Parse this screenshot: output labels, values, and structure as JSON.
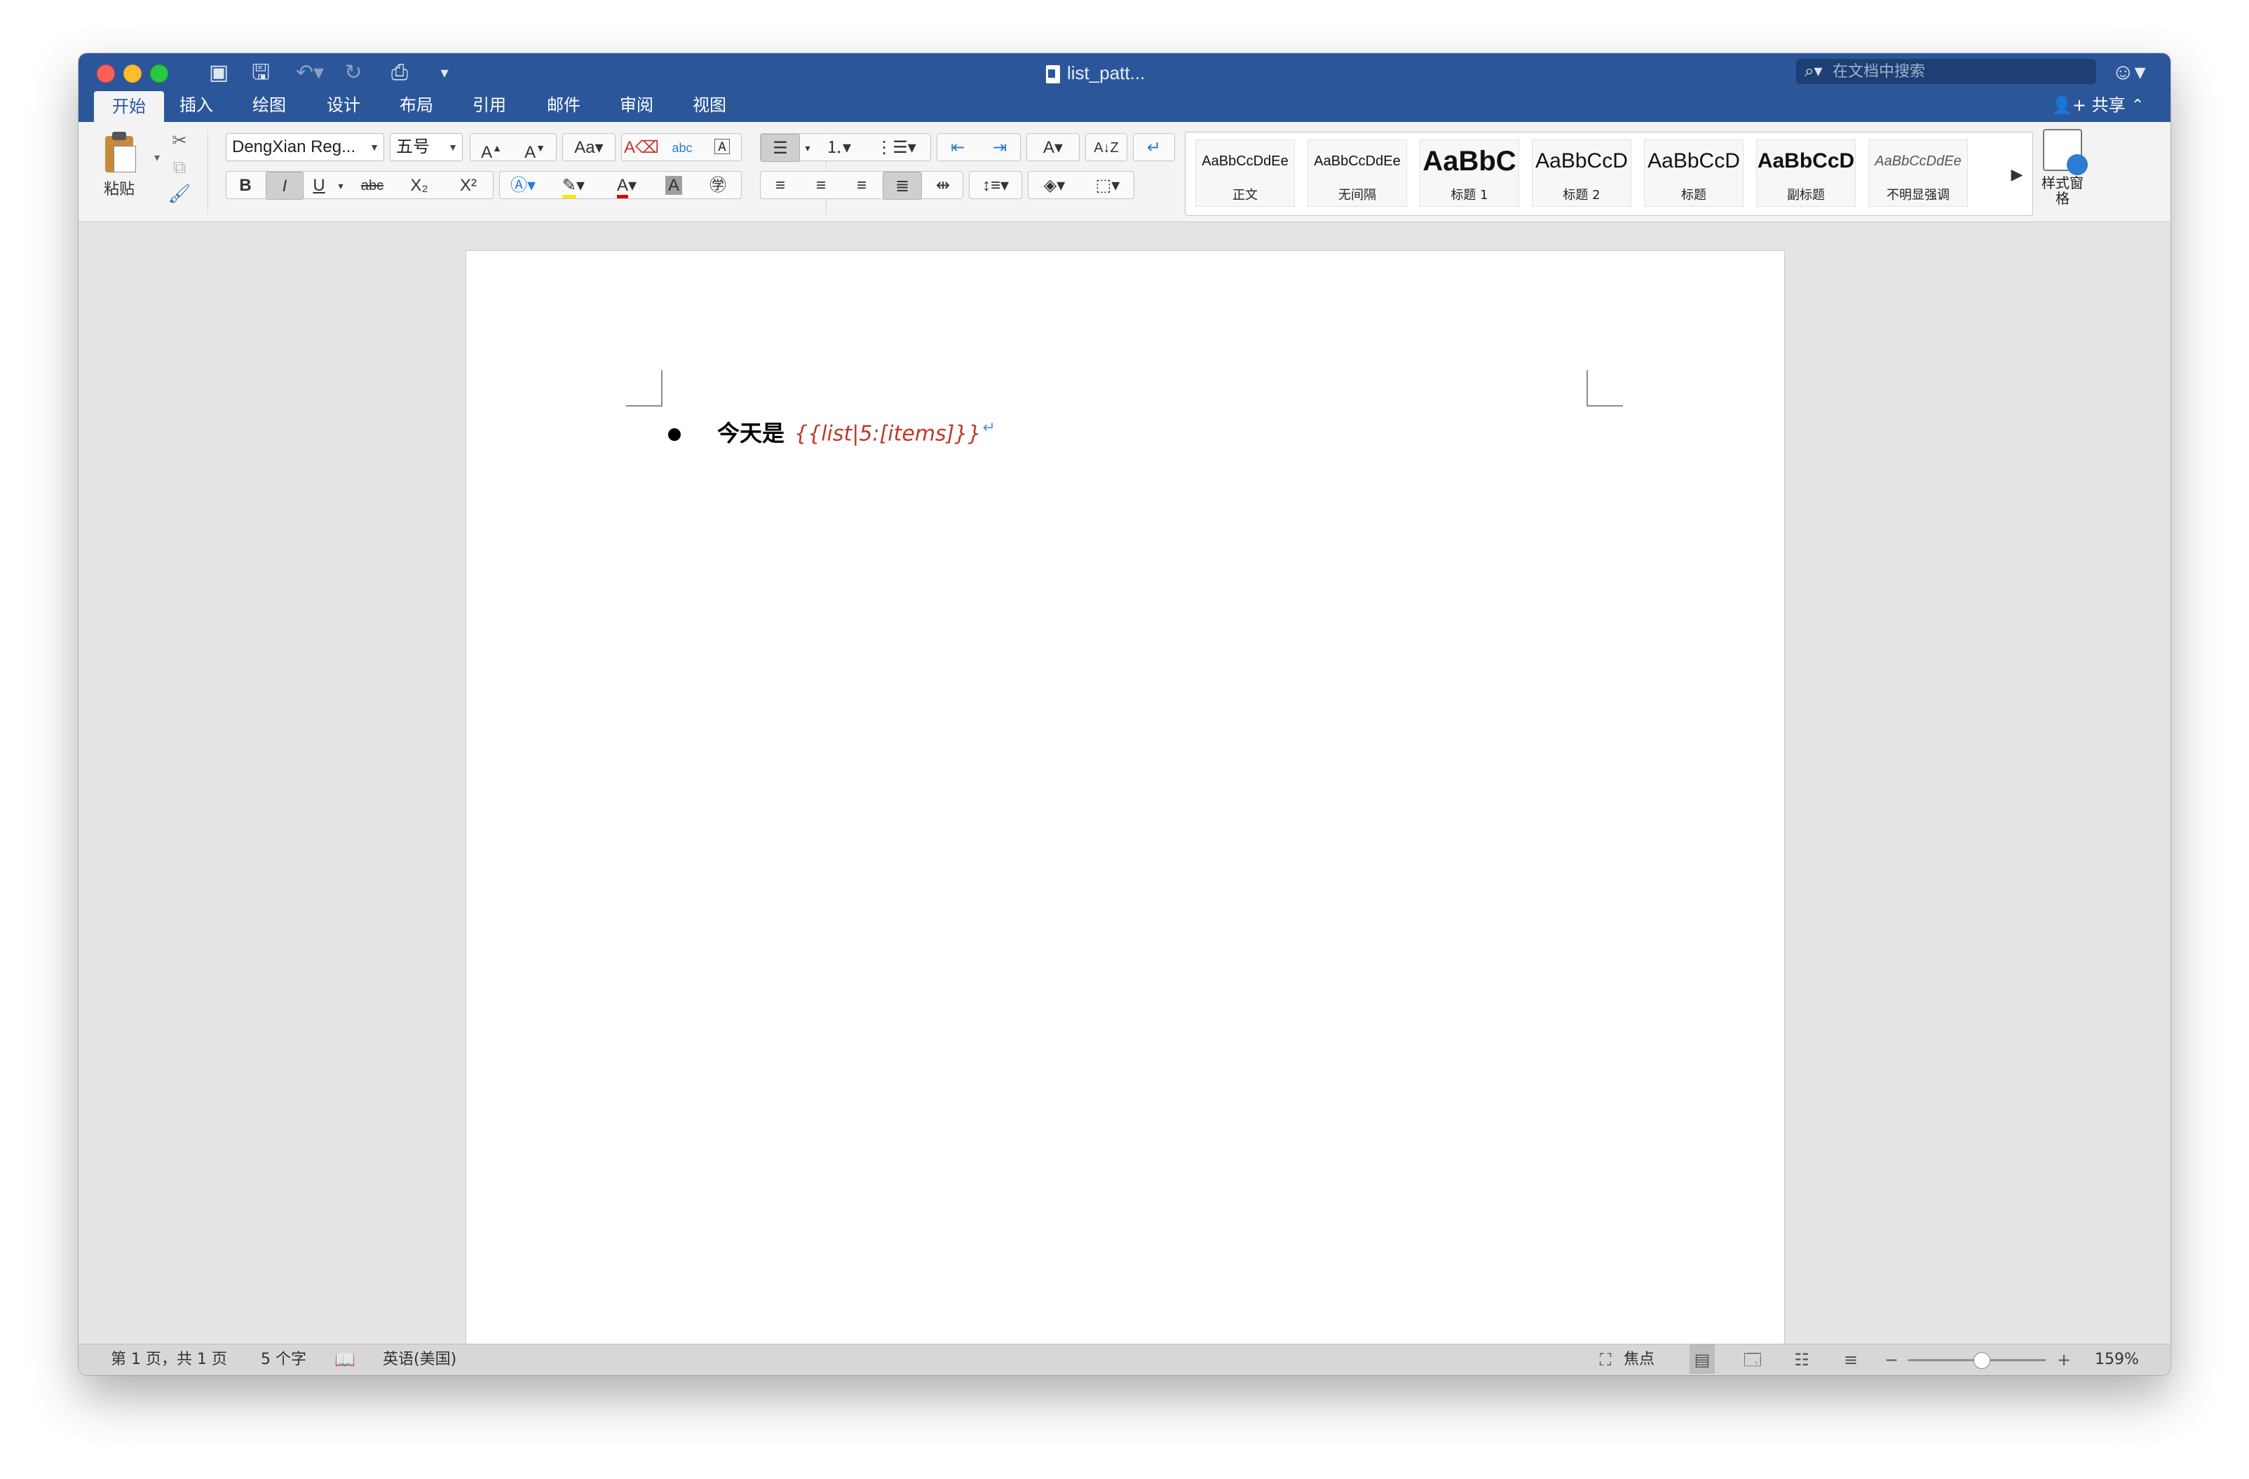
{
  "window": {
    "title": "list_patt...",
    "search_placeholder": "在文档中搜索"
  },
  "quick_access": [
    "sidebar-icon",
    "save-icon",
    "undo-icon",
    "redo-icon",
    "print-icon",
    "customize-icon"
  ],
  "tabs": [
    {
      "label": "开始",
      "active": true
    },
    {
      "label": "插入"
    },
    {
      "label": "绘图"
    },
    {
      "label": "设计"
    },
    {
      "label": "布局"
    },
    {
      "label": "引用"
    },
    {
      "label": "邮件"
    },
    {
      "label": "审阅"
    },
    {
      "label": "视图"
    }
  ],
  "share_label": "共享",
  "ribbon": {
    "paste_label": "粘贴",
    "font_name": "DengXian Reg...",
    "font_size": "五号",
    "bold": "B",
    "italic": "I",
    "underline": "U",
    "strike": "abc",
    "subscript": "X₂",
    "superscript": "X²",
    "styles": [
      {
        "sample": "AaBbCcDdEe",
        "name": "正文"
      },
      {
        "sample": "AaBbCcDdEe",
        "name": "无间隔"
      },
      {
        "sample": "AaBbC",
        "name": "标题 1"
      },
      {
        "sample": "AaBbCcD",
        "name": "标题 2"
      },
      {
        "sample": "AaBbCcD",
        "name": "标题"
      },
      {
        "sample": "AaBbCcD",
        "name": "副标题"
      },
      {
        "sample": "AaBbCcDdEe",
        "name": "不明显强调"
      }
    ],
    "styles_pane_label": "样式窗格"
  },
  "document": {
    "bullet_text": "今天是",
    "field_text": "{{list|5:[items]}}",
    "paragraph_mark": "↵"
  },
  "status": {
    "page_info": "第 1 页，共 1 页",
    "word_count": "5 个字",
    "language": "英语(美国)",
    "focus_label": "焦点",
    "zoom": "159%",
    "zoom_fraction": 0.53
  }
}
